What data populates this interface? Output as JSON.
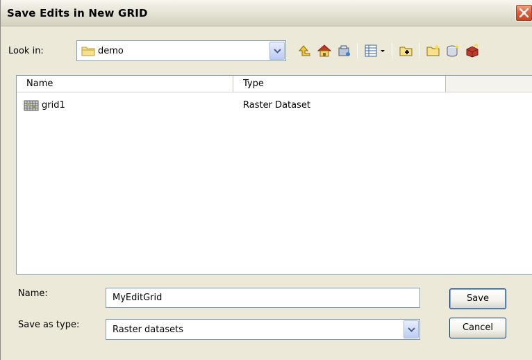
{
  "window": {
    "title": "Save Edits in New GRID"
  },
  "lookin": {
    "label": "Look in:",
    "value": "demo"
  },
  "toolbar": {
    "buttons": [
      "up-one-level-icon",
      "home-icon",
      "connect-folder-icon",
      "view-menu-icon",
      "add-data-icon",
      "new-folder-icon",
      "new-geodatabase-icon",
      "toolbox-icon"
    ]
  },
  "filelist": {
    "columns": [
      "Name",
      "Type"
    ],
    "rows": [
      {
        "name": "grid1",
        "type": "Raster Dataset",
        "icon": "raster-grid-icon"
      }
    ]
  },
  "form": {
    "name_label": "Name:",
    "name_value": "MyEditGrid",
    "type_label": "Save as type:",
    "type_value": "Raster datasets"
  },
  "buttons": {
    "save": "Save",
    "cancel": "Cancel"
  },
  "colors": {
    "close_button": "#e0613c",
    "field_border": "#7f9db9",
    "dialog_bg": "#ece9d8"
  }
}
